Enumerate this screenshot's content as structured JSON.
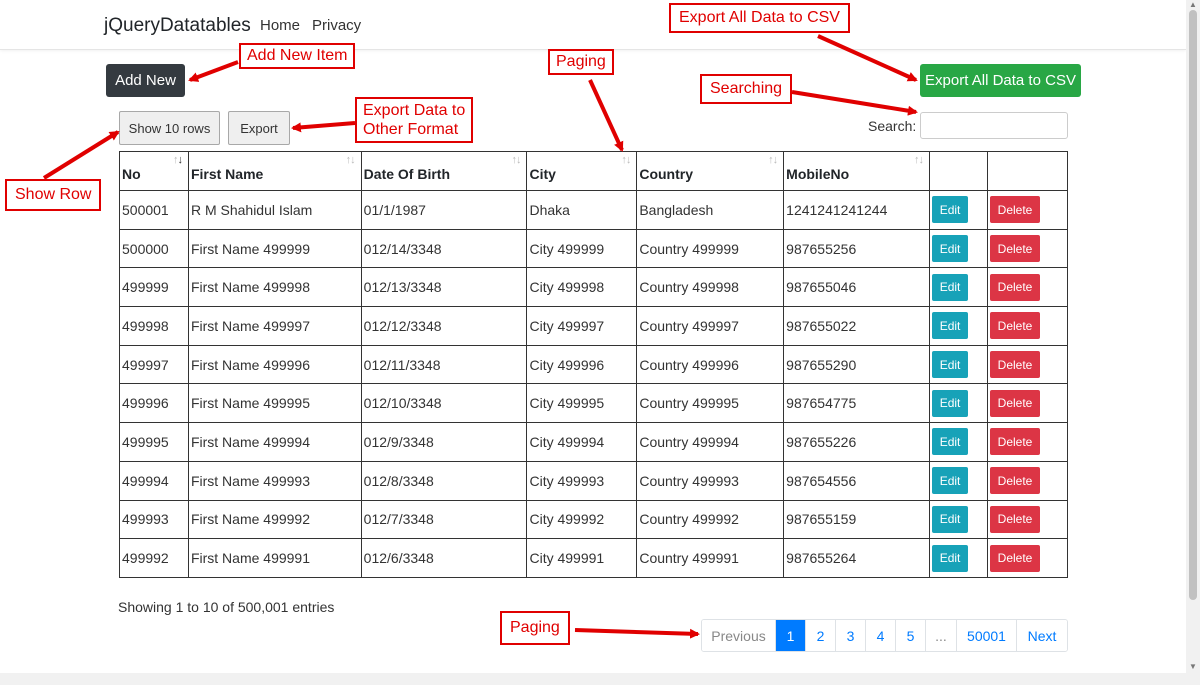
{
  "navbar": {
    "brand": "jQueryDatatables",
    "links": [
      "Home",
      "Privacy"
    ]
  },
  "toolbar": {
    "add_new": "Add New",
    "export_all_csv": "Export All Data to CSV",
    "show_rows": "Show 10 rows",
    "export": "Export",
    "search_label": "Search:",
    "search_value": ""
  },
  "table": {
    "columns": [
      "No",
      "First Name",
      "Date Of Birth",
      "City",
      "Country",
      "MobileNo",
      "",
      ""
    ],
    "edit_label": "Edit",
    "delete_label": "Delete",
    "rows": [
      [
        "500001",
        "R M Shahidul Islam",
        "01/1/1987",
        "Dhaka",
        "Bangladesh",
        "1241241241244"
      ],
      [
        "500000",
        "First Name 499999",
        "012/14/3348",
        "City 499999",
        "Country 499999",
        "987655256"
      ],
      [
        "499999",
        "First Name 499998",
        "012/13/3348",
        "City 499998",
        "Country 499998",
        "987655046"
      ],
      [
        "499998",
        "First Name 499997",
        "012/12/3348",
        "City 499997",
        "Country 499997",
        "987655022"
      ],
      [
        "499997",
        "First Name 499996",
        "012/11/3348",
        "City 499996",
        "Country 499996",
        "987655290"
      ],
      [
        "499996",
        "First Name 499995",
        "012/10/3348",
        "City 499995",
        "Country 499995",
        "987654775"
      ],
      [
        "499995",
        "First Name 499994",
        "012/9/3348",
        "City 499994",
        "Country 499994",
        "987655226"
      ],
      [
        "499994",
        "First Name 499993",
        "012/8/3348",
        "City 499993",
        "Country 499993",
        "987654556"
      ],
      [
        "499993",
        "First Name 499992",
        "012/7/3348",
        "City 499992",
        "Country 499992",
        "987655159"
      ],
      [
        "499992",
        "First Name 499991",
        "012/6/3348",
        "City 499991",
        "Country 499991",
        "987655264"
      ]
    ]
  },
  "footer": {
    "info": "Showing 1 to 10 of 500,001 entries",
    "pagination": [
      "Previous",
      "1",
      "2",
      "3",
      "4",
      "5",
      "...",
      "50001",
      "Next"
    ],
    "active_page": "1"
  },
  "annotations": {
    "add_new_item": "Add New Item",
    "export_csv": "Export All Data to CSV",
    "paging_top": "Paging",
    "searching": "Searching",
    "export_other_line1": "Export Data to",
    "export_other_line2": "Other Format",
    "show_row": "Show Row",
    "paging_bottom": "Paging"
  },
  "colors": {
    "annotation_red": "#e00000",
    "primary": "#007bff",
    "success": "#28a745",
    "info": "#17a2b8",
    "danger": "#dc3545",
    "dark": "#343a40"
  }
}
